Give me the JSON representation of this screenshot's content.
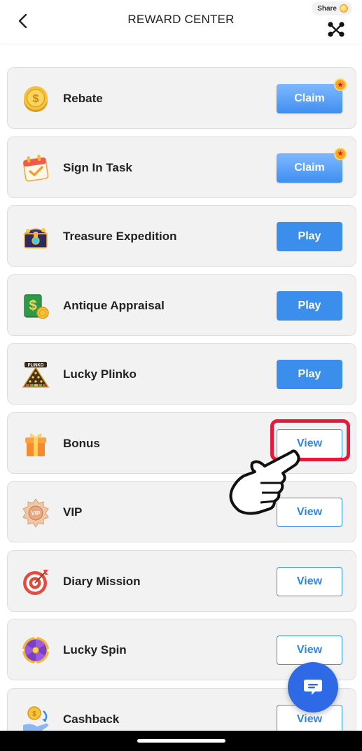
{
  "header": {
    "title": "REWARD CENTER",
    "share_label": "Share"
  },
  "items": [
    {
      "label": "Rebate",
      "button": "Claim",
      "style": "claim",
      "icon": "coin-icon",
      "badge": true
    },
    {
      "label": "Sign In Task",
      "button": "Claim",
      "style": "claim",
      "icon": "calendar-icon",
      "badge": true
    },
    {
      "label": "Treasure Expedition",
      "button": "Play",
      "style": "play",
      "icon": "treasure-chest-icon",
      "badge": false
    },
    {
      "label": "Antique Appraisal",
      "button": "Play",
      "style": "play",
      "icon": "money-card-icon",
      "badge": false
    },
    {
      "label": "Lucky Plinko",
      "button": "Play",
      "style": "play",
      "icon": "plinko-icon",
      "icon_text": "PLINKO",
      "badge": false
    },
    {
      "label": "Bonus",
      "button": "View",
      "style": "view",
      "icon": "gift-box-icon",
      "badge": false
    },
    {
      "label": "VIP",
      "button": "View",
      "style": "view",
      "icon": "vip-medal-icon",
      "icon_text": "VIP",
      "badge": false
    },
    {
      "label": "Diary Mission",
      "button": "View",
      "style": "view",
      "icon": "target-icon",
      "badge": false
    },
    {
      "label": "Lucky Spin",
      "button": "View",
      "style": "view",
      "icon": "spin-wheel-icon",
      "badge": false
    },
    {
      "label": "Cashback",
      "button": "View",
      "style": "view",
      "icon": "cashback-icon",
      "badge": false
    }
  ],
  "colors": {
    "accent": "#3b8eec",
    "highlight": "#e6193a",
    "chat": "#2f6ae6"
  }
}
